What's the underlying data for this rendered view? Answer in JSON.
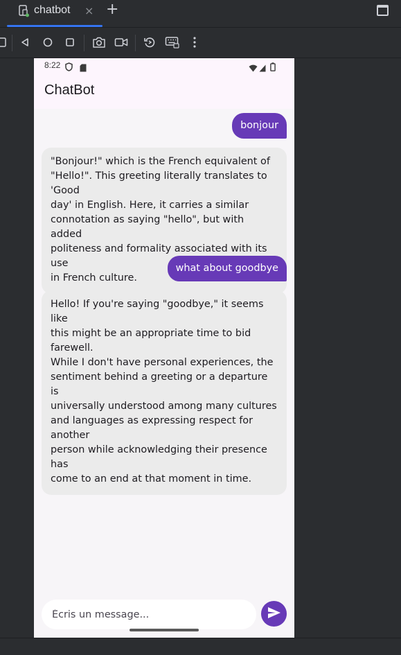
{
  "ide": {
    "tab_label": "chatbot",
    "tab_close_glyph": "×",
    "add_tab_glyph": "+"
  },
  "toolbar": {
    "icons": [
      "back-icon",
      "home-icon",
      "overview-icon",
      "camera-icon",
      "video-icon",
      "rotate-icon",
      "keyboard-icon",
      "more-icon"
    ]
  },
  "phone": {
    "status": {
      "time": "8:22"
    },
    "app": {
      "title": "ChatBot"
    },
    "messages": [
      {
        "role": "user",
        "text": "bonjour"
      },
      {
        "role": "bot",
        "lines": [
          "\"Bonjour!\" which is the French equivalent of",
          "\"Hello!\". This greeting literally translates to 'Good",
          "day' in English. Here, it carries a similar",
          "connotation as saying \"hello\", but with added",
          "politeness and formality associated with its use",
          "in French culture."
        ]
      },
      {
        "role": "user",
        "text": "what about goodbye"
      },
      {
        "role": "bot",
        "lines": [
          "Hello! If you're saying \"goodbye,\" it seems like",
          "this might be an appropriate time to bid farewell.",
          "While I don't have personal experiences, the",
          "sentiment behind a greeting or a departure is",
          "universally understood among many cultures",
          "and languages as expressing respect for another",
          "person while acknowledging their presence has",
          "come to an end at that moment in time."
        ]
      }
    ],
    "input": {
      "placeholder": "Écris un message...",
      "value": ""
    }
  },
  "colors": {
    "accent": "#673ab7",
    "ide_tab_underline": "#3574f0",
    "bot_bubble": "#ebebeb",
    "app_bar": "#fdf5fd"
  }
}
